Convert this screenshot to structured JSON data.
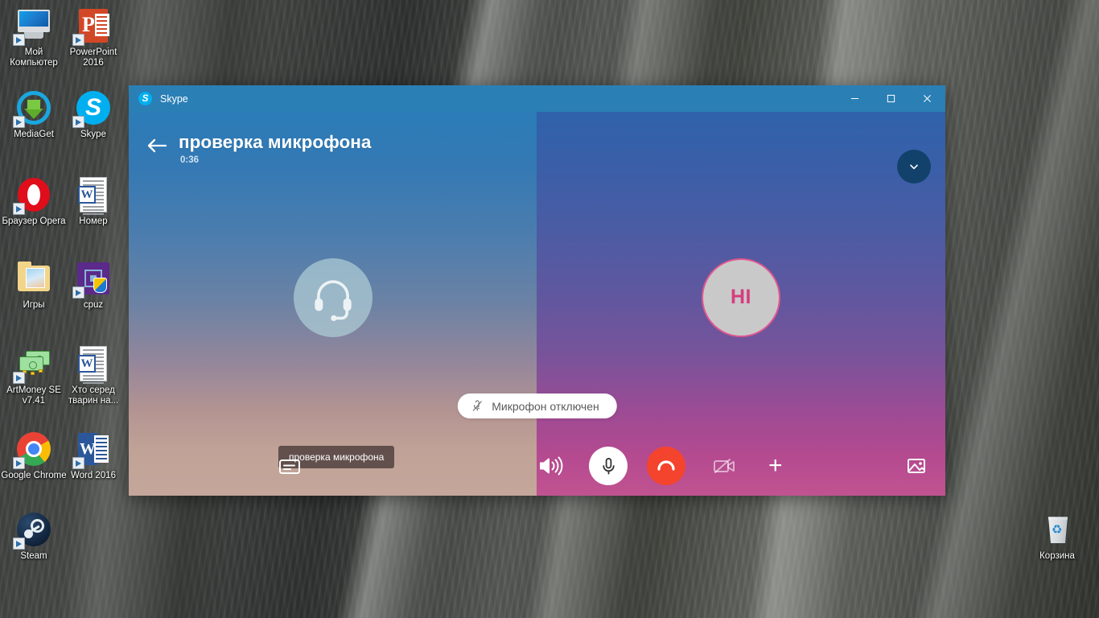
{
  "desktop": {
    "icons": [
      {
        "label": "Мой Компьютер",
        "icon": "my-computer-icon",
        "shortcut": true
      },
      {
        "label": "PowerPoint 2016",
        "icon": "powerpoint-icon",
        "shortcut": true
      },
      {
        "label": "MediaGet",
        "icon": "mediaget-icon",
        "shortcut": true
      },
      {
        "label": "Skype",
        "icon": "skype-icon",
        "shortcut": true
      },
      {
        "label": "Браузер Opera",
        "icon": "opera-icon",
        "shortcut": true
      },
      {
        "label": "Номер",
        "icon": "word-document-icon",
        "shortcut": false
      },
      {
        "label": "Игры",
        "icon": "folder-icon",
        "shortcut": false
      },
      {
        "label": "cpuz",
        "icon": "cpuz-icon",
        "shortcut": true
      },
      {
        "label": "ArtMoney SE v7.41",
        "icon": "artmoney-icon",
        "shortcut": true
      },
      {
        "label": "Хто серед тварин на...",
        "icon": "word-document-icon",
        "shortcut": false
      },
      {
        "label": "Google Chrome",
        "icon": "chrome-icon",
        "shortcut": true
      },
      {
        "label": "Word 2016",
        "icon": "word-icon",
        "shortcut": true
      },
      {
        "label": "Steam",
        "icon": "steam-icon",
        "shortcut": true
      },
      {
        "label": "Корзина",
        "icon": "recycle-bin-icon",
        "shortcut": false
      }
    ]
  },
  "window": {
    "app_title": "Skype",
    "logo_letter": "S",
    "controls": {
      "minimize": "—",
      "maximize": "▢",
      "close": "✕"
    }
  },
  "call": {
    "title": "проверка микрофона",
    "timer": "0:36",
    "back_icon": "back-arrow-icon",
    "collapse_icon": "chevron-down-icon",
    "peer_name_chip": "проверка микрофона",
    "participants": {
      "left": {
        "avatar_icon": "headset-icon",
        "type": "echo-test"
      },
      "right": {
        "initials": "HI",
        "avatar_color": "#c9c9c9",
        "initials_color": "#d63d7e",
        "border_color": "#e0578f"
      }
    },
    "mic_toast": {
      "label": "Микрофон отключен",
      "icon": "microphone-muted-icon"
    },
    "toolbar": [
      {
        "name": "chat-button",
        "icon": "chat-icon",
        "label": ""
      },
      {
        "name": "speaker-button",
        "icon": "speaker-icon",
        "label": ""
      },
      {
        "name": "microphone-toggle-button",
        "icon": "microphone-icon",
        "label": ""
      },
      {
        "name": "end-call-button",
        "icon": "end-call-icon",
        "label": ""
      },
      {
        "name": "video-toggle-button",
        "icon": "video-off-icon",
        "label": ""
      },
      {
        "name": "add-people-button",
        "icon": "plus-icon",
        "label": "+"
      },
      {
        "name": "snapshot-button",
        "icon": "image-icon",
        "label": ""
      }
    ]
  },
  "colors": {
    "titlebar": "#2a7fb5",
    "skype_blue": "#00aff0",
    "end_call_red": "#f4442e",
    "collapse_dark": "#12426b"
  }
}
